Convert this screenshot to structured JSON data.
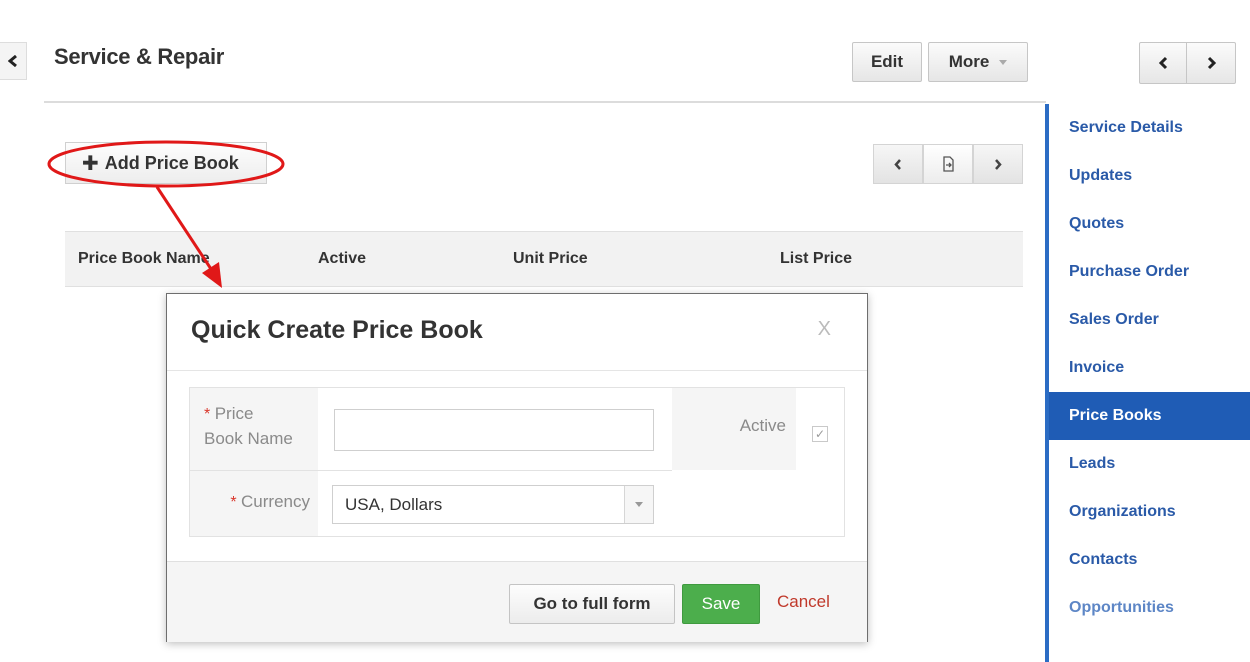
{
  "header": {
    "title": "Service & Repair",
    "edit_label": "Edit",
    "more_label": "More"
  },
  "sidebar": {
    "items": [
      {
        "label": "Service Details"
      },
      {
        "label": "Updates"
      },
      {
        "label": "Quotes"
      },
      {
        "label": "Purchase Order"
      },
      {
        "label": "Sales Order"
      },
      {
        "label": "Invoice"
      },
      {
        "label": "Price Books"
      },
      {
        "label": "Leads"
      },
      {
        "label": "Organizations"
      },
      {
        "label": "Contacts"
      },
      {
        "label": "Opportunities"
      }
    ],
    "active": "Price Books",
    "accent": "#1f5cb5"
  },
  "main": {
    "add_label": "Add Price Book",
    "table": {
      "columns": [
        "Price Book Name",
        "Active",
        "Unit Price",
        "List Price"
      ]
    }
  },
  "modal": {
    "title": "Quick Create Price Book",
    "close_label": "X",
    "fields": {
      "name_label_line1": "Price",
      "name_label_line2": "Book Name",
      "required_mark": "*",
      "name_value": "",
      "active_label": "Active",
      "active_checked": true,
      "currency_label": "Currency",
      "currency_value": "USA, Dollars"
    },
    "footer": {
      "full_form_label": "Go to full form",
      "save_label": "Save",
      "cancel_label": "Cancel"
    }
  },
  "colors": {
    "save_green": "#4cae4c",
    "annotation_red": "#e01818",
    "cancel_red": "#c0392b",
    "link_blue": "#2a5aa8"
  }
}
